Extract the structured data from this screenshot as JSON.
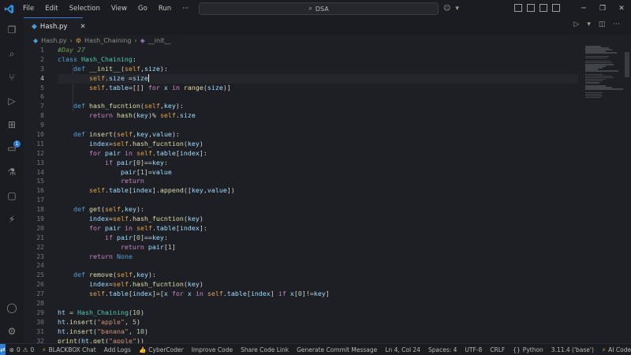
{
  "titlebar": {
    "menu": [
      "File",
      "Edit",
      "Selection",
      "View",
      "Go",
      "Run",
      "···"
    ],
    "search_text": "DSA"
  },
  "tab": {
    "filename": "Hash.py"
  },
  "breadcrumb": {
    "file": "Hash.py",
    "class": "Hash_Chaining",
    "method": "__init__"
  },
  "editor": {
    "line_numbers": [
      "1",
      "2",
      "3",
      "4",
      "5",
      "6",
      "7",
      "8",
      "9",
      "10",
      "11",
      "12",
      "13",
      "14",
      "15",
      "16",
      "17",
      "18",
      "19",
      "20",
      "21",
      "22",
      "23",
      "24",
      "25",
      "26",
      "27",
      "28",
      "29",
      "30",
      "31",
      "32"
    ],
    "active_line": 4
  },
  "activity_badge": "1",
  "statusbar": {
    "errors": "0",
    "warnings": "0",
    "blackbox": "BLACKBOX Chat",
    "add_logs": "Add Logs",
    "cybercoder": "CyberCoder",
    "improve": "Improve Code",
    "share": "Share Code Link",
    "commit": "Generate Commit Message",
    "position": "Ln 4, Col 24",
    "spaces": "Spaces: 4",
    "encoding": "UTF-8",
    "eol": "CRLF",
    "language": "Python",
    "interpreter": "3.11.4 ('base')",
    "ai_chat": "AI Code Chat"
  }
}
